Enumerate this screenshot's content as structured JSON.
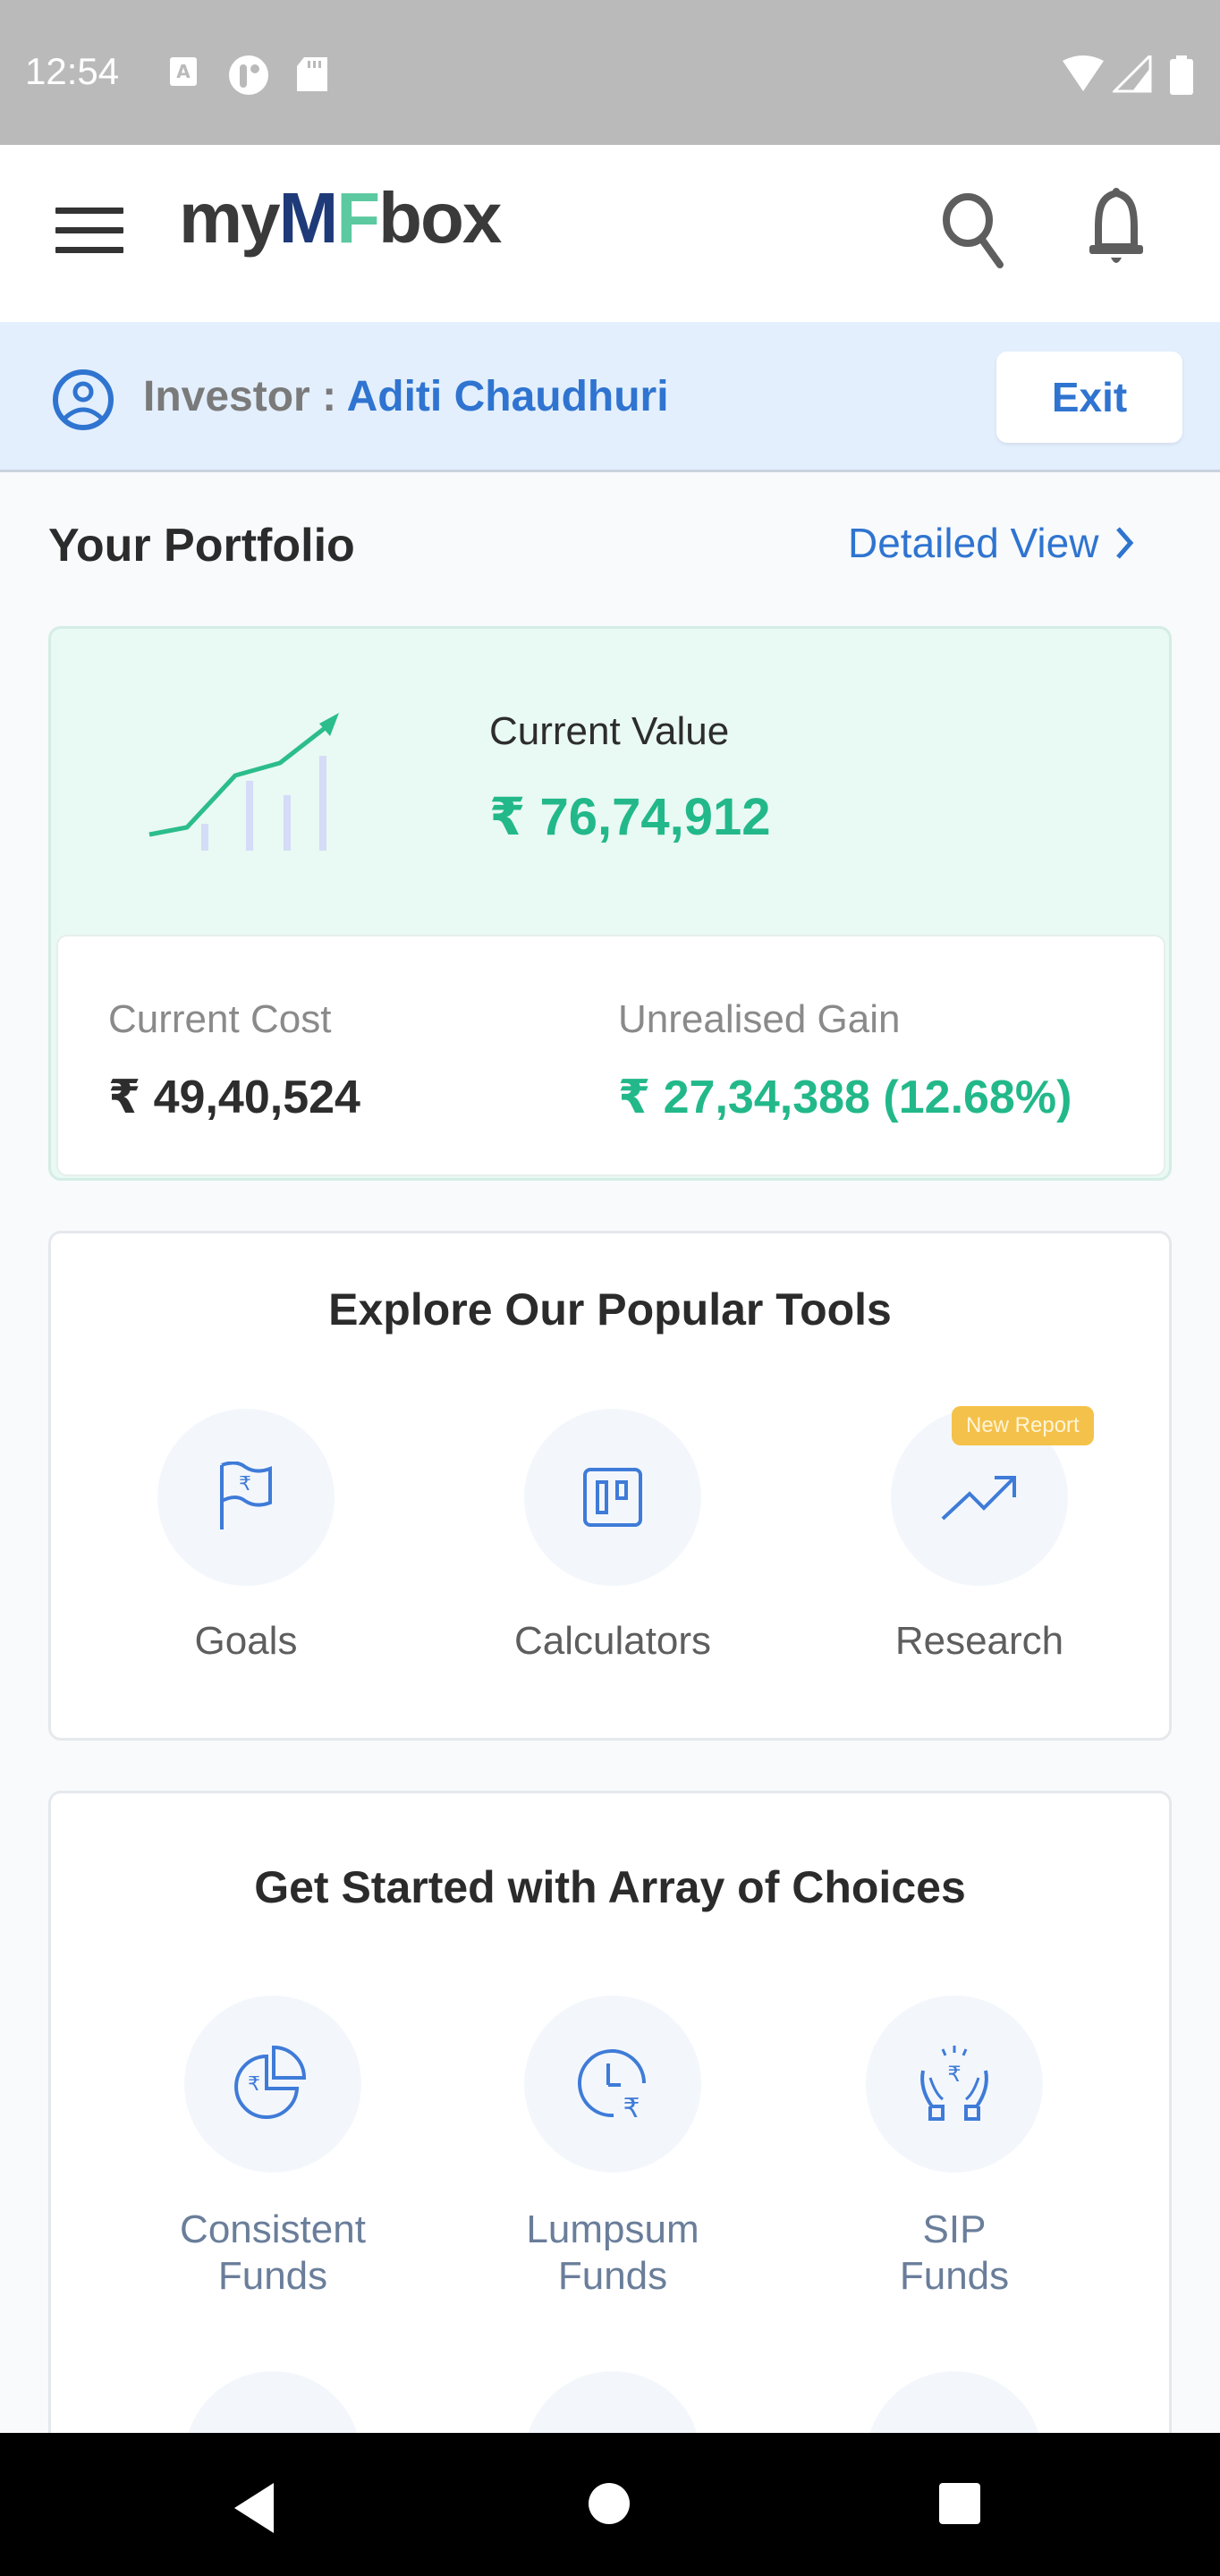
{
  "status_bar": {
    "time": "12:54",
    "left_icons": [
      "accessibility-a-icon",
      "app-circle-icon",
      "sd-card-icon"
    ],
    "right_icons": [
      "wifi-icon",
      "signal-icon",
      "battery-icon"
    ]
  },
  "app_bar": {
    "logo": {
      "part1": "my",
      "part2": "M",
      "part3": "F",
      "part4": "box"
    },
    "menu_icon": "hamburger-icon",
    "search_icon": "search-icon",
    "notification_icon": "bell-icon"
  },
  "investor_bar": {
    "label": "Investor : ",
    "name": "Aditi Chaudhuri",
    "exit_label": "Exit"
  },
  "portfolio": {
    "title": "Your Portfolio",
    "detailed_view_label": "Detailed View",
    "current_value_label": "Current Value",
    "current_value": "₹ 76,74,912",
    "current_cost_label": "Current Cost",
    "current_cost": "₹ 49,40,524",
    "unrealised_gain_label": "Unrealised Gain",
    "unrealised_gain": "₹ 27,34,388 (12.68%)"
  },
  "tools": {
    "title": "Explore Our Popular Tools",
    "items": [
      {
        "label": "Goals",
        "icon": "flag-rupee-icon"
      },
      {
        "label": "Calculators",
        "icon": "calculator-icon"
      },
      {
        "label": "Research",
        "icon": "trend-up-icon",
        "badge": "New Report"
      }
    ]
  },
  "choices": {
    "title": "Get Started with Array of Choices",
    "items": [
      {
        "line1": "Consistent",
        "line2": "Funds",
        "icon": "pie-rupee-icon"
      },
      {
        "line1": "Lumpsum",
        "line2": "Funds",
        "icon": "clock-rupee-icon"
      },
      {
        "line1": "SIP",
        "line2": "Funds",
        "icon": "hands-rupee-icon"
      }
    ]
  },
  "colors": {
    "accent_blue": "#2f74d0",
    "gain_green": "#22b88a",
    "logo_navy": "#1f3a78",
    "logo_green": "#5cc9a0",
    "badge_yellow": "#f4c24a"
  }
}
